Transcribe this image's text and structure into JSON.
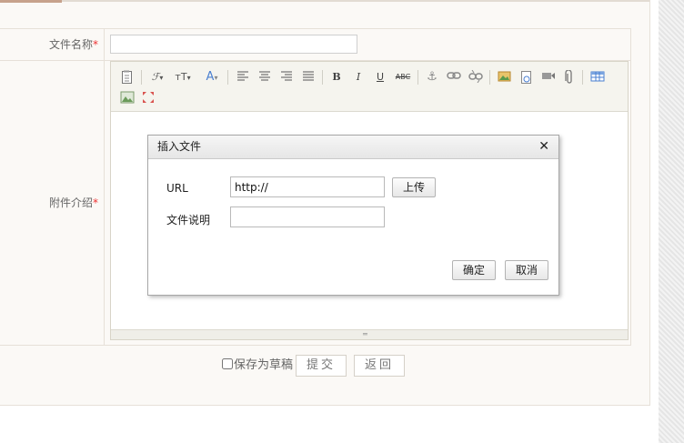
{
  "form": {
    "filename_label": "文件名称",
    "filename_value": "",
    "attachment_label": "附件介绍",
    "required_mark": "*"
  },
  "toolbar": {
    "icons": [
      "source-icon",
      "font-family-icon",
      "font-size-icon",
      "font-color-icon",
      "align-left-icon",
      "align-center-icon",
      "align-right-icon",
      "justify-icon",
      "bold-icon",
      "italic-icon",
      "underline-icon",
      "strikethrough-icon",
      "anchor-icon",
      "link-icon",
      "unlink-icon",
      "insert-image-icon",
      "insert-flash-icon",
      "insert-media-icon",
      "attachment-icon",
      "table-icon",
      "picture-icon",
      "fullscreen-icon"
    ],
    "strikethrough_label": "ABC",
    "bold_label": "B",
    "italic_label": "I",
    "underline_label": "U"
  },
  "dialog": {
    "title": "插入文件",
    "close_symbol": "✕",
    "url_label": "URL",
    "url_value": "http://",
    "upload_button": "上传",
    "desc_label": "文件说明",
    "desc_value": "",
    "confirm_button": "确定",
    "cancel_button": "取消"
  },
  "footer": {
    "save_draft_label": "保存为草稿",
    "submit_button": "提交",
    "back_button": "返回"
  },
  "colors": {
    "required": "#ee3333",
    "panel_bg": "#fbf9f6",
    "accent_tab": "#c7a28c"
  }
}
